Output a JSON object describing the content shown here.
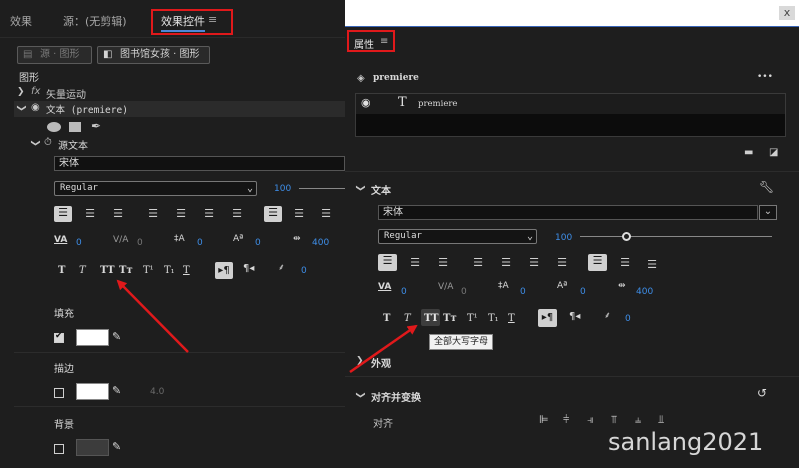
{
  "left": {
    "tabs": [
      "效果",
      "源：(无剪辑)",
      "效果控件",
      "≡"
    ],
    "crumb_source": "源 · 图形",
    "crumb_clip": "图书馆女孩 · 图形",
    "section": "图形",
    "vector_motion": "矢量运动",
    "text_layer": "文本 (premiere)",
    "fx": "fx",
    "source_text": "源文本",
    "font": "宋体",
    "style": "Regular",
    "size": "100",
    "tracking_val": "0",
    "kerning_val": "0",
    "leading_val": "0",
    "baseline_val": "0",
    "tab_val": "400",
    "tsume_val": "0",
    "fill": "填充",
    "stroke": "描边",
    "stroke_width": "4.0",
    "background": "背景",
    "fill_color": "#ffffff",
    "stroke_color": "#ffffff",
    "bg_color": "#3c3c3c"
  },
  "right": {
    "close": "x",
    "panel_title": "属性",
    "menu": "≡",
    "layer_name": "premiere",
    "layer_item": "premiere",
    "more": "•••",
    "text_section": "文本",
    "font": "宋体",
    "style": "Regular",
    "size": "100",
    "tracking_val": "0",
    "kerning_val": "0",
    "leading_val": "0",
    "baseline_val": "0",
    "tab_val": "400",
    "tsume_val": "0",
    "tooltip": "全部大写字母",
    "appearance": "外观",
    "align_section": "对齐并变换",
    "align_label": "对齐"
  },
  "typo_buttons": [
    "T",
    "T",
    "TT",
    "Tт",
    "T¹",
    "T₁",
    "T"
  ],
  "watermark": "sanlang2021",
  "accent_red": "#e0191b",
  "accent_blue": "#3e8ee8"
}
